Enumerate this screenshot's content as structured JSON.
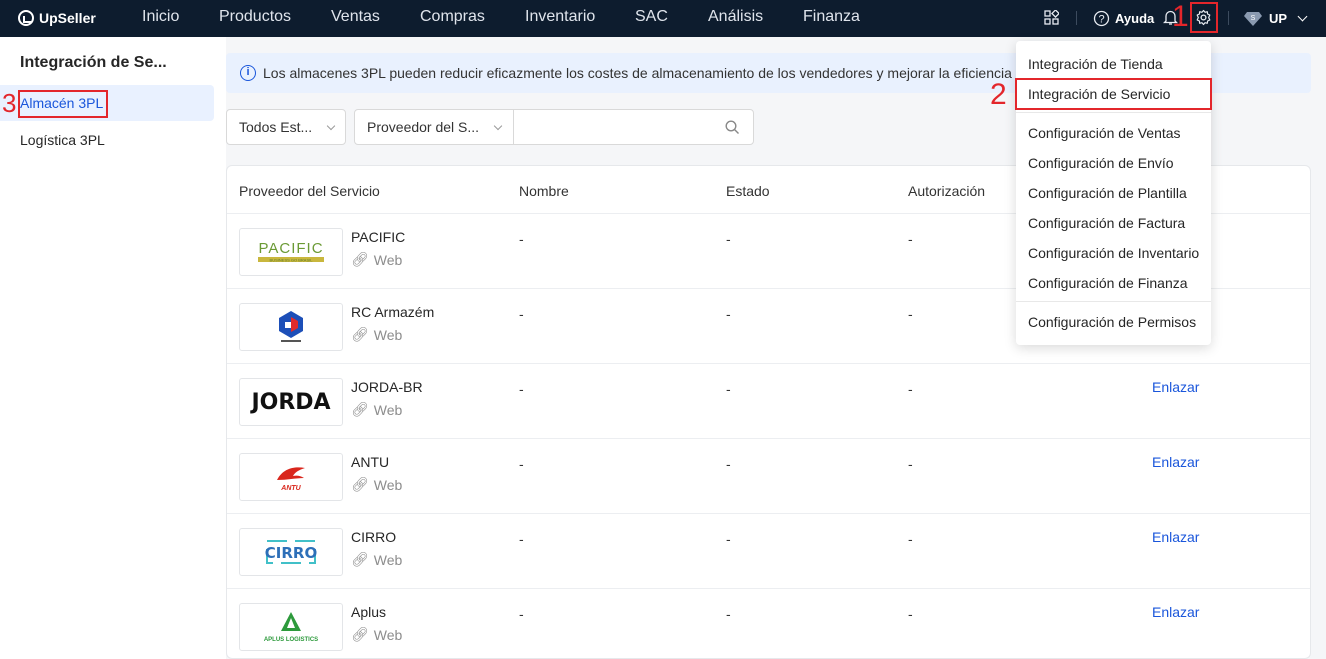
{
  "brand": "UpSeller",
  "nav": {
    "items": [
      "Inicio",
      "Productos",
      "Ventas",
      "Compras",
      "Inventario",
      "SAC",
      "Análisis",
      "Finanza"
    ],
    "help": "Ayuda",
    "user": "UP"
  },
  "annotations": {
    "n1": "1",
    "n2": "2",
    "n3": "3"
  },
  "sidebar": {
    "title": "Integración de Se...",
    "items": [
      {
        "label": "Almacén 3PL",
        "active": true
      },
      {
        "label": "Logística 3PL",
        "active": false
      }
    ]
  },
  "info_banner": "Los almacenes 3PL pueden reducir eficazmente los costes de almacenamiento de los vendedores y mejorar la eficiencia",
  "filters": {
    "status_select": "Todos Est...",
    "provider_select": "Proveedor del S...",
    "search_value": ""
  },
  "table": {
    "headers": [
      "Proveedor del Servicio",
      "Nombre",
      "Estado",
      "Autorización"
    ],
    "rows": [
      {
        "provider": "PACIFIC",
        "web": "Web",
        "nombre": "-",
        "estado": "-",
        "autorizacion": "-",
        "action": ""
      },
      {
        "provider": "RC Armazém",
        "web": "Web",
        "nombre": "-",
        "estado": "-",
        "autorizacion": "-",
        "action": ""
      },
      {
        "provider": "JORDA-BR",
        "web": "Web",
        "nombre": "-",
        "estado": "-",
        "autorizacion": "-",
        "action": "Enlazar"
      },
      {
        "provider": "ANTU",
        "web": "Web",
        "nombre": "-",
        "estado": "-",
        "autorizacion": "-",
        "action": "Enlazar"
      },
      {
        "provider": "CIRRO",
        "web": "Web",
        "nombre": "-",
        "estado": "-",
        "autorizacion": "-",
        "action": "Enlazar"
      },
      {
        "provider": "Aplus",
        "web": "Web",
        "nombre": "-",
        "estado": "-",
        "autorizacion": "-",
        "action": "Enlazar"
      }
    ]
  },
  "logos": {
    "pacific": "PACIFIC",
    "pacific_sub": "BUSINESS GO BRASIL",
    "jorda": "JORDA",
    "antu": "ANTU",
    "cirro": "CIRRO",
    "aplus": "APLUS LOGISTICS"
  },
  "settings_menu": {
    "group1": [
      "Integración de Tienda",
      "Integración de Servicio"
    ],
    "group2": [
      "Configuración de Ventas",
      "Configuración de Envío",
      "Configuración de Plantilla",
      "Configuración de Factura",
      "Configuración de Inventario",
      "Configuración de Finanza"
    ],
    "group3": [
      "Configuración de Permisos"
    ]
  },
  "colors": {
    "nav_bg": "#0d1c2e",
    "accent": "#1a56db",
    "annotation": "#e3262b"
  }
}
